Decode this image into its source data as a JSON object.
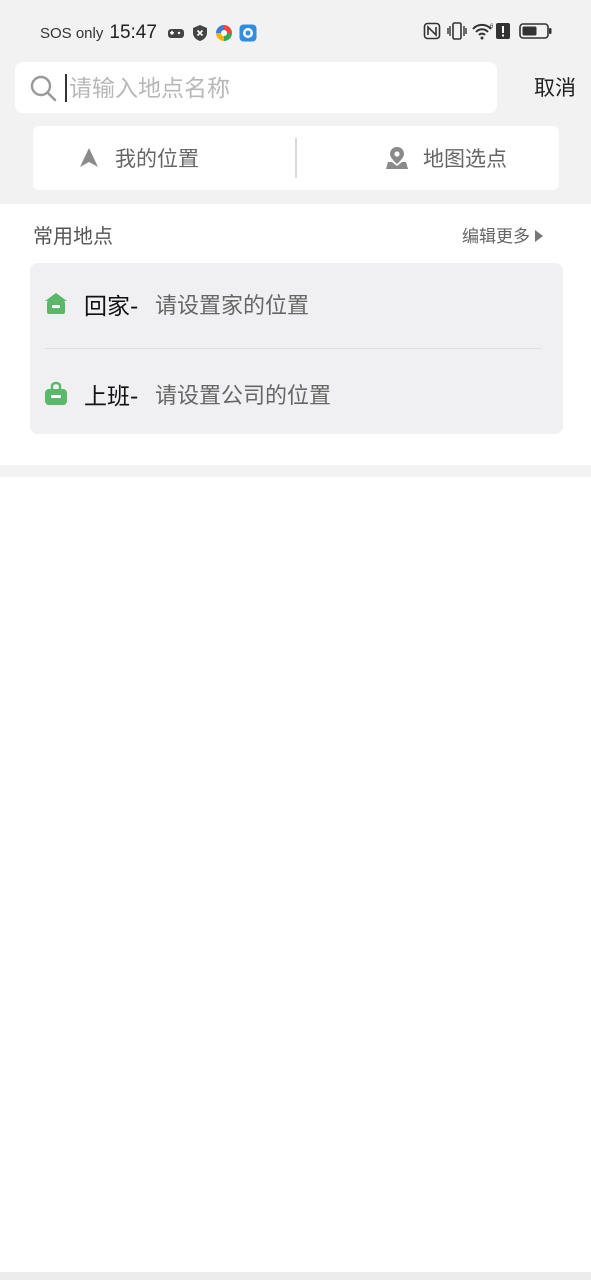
{
  "status_bar": {
    "carrier_text": "SOS only",
    "time": "15:47",
    "icons": [
      "game-controller-icon",
      "shield-x-icon",
      "multicolor-app-icon",
      "blue-app-icon",
      "nfc-icon",
      "vibrate-icon",
      "wifi-6-icon",
      "alert-icon",
      "battery-icon"
    ]
  },
  "search": {
    "placeholder": "请输入地点名称",
    "value": "",
    "cancel_label": "取消"
  },
  "choices": {
    "my_location": "我的位置",
    "map_select": "地图选点"
  },
  "frequent": {
    "title": "常用地点",
    "edit_more": "编辑更多",
    "items": [
      {
        "name": "回家-",
        "desc": "请设置家的位置",
        "icon": "home-icon"
      },
      {
        "name": "上班-",
        "desc": "请设置公司的位置",
        "icon": "briefcase-icon"
      }
    ]
  },
  "colors": {
    "accent_green": "#5bb86a",
    "icon_gray": "#8a8a8a"
  }
}
